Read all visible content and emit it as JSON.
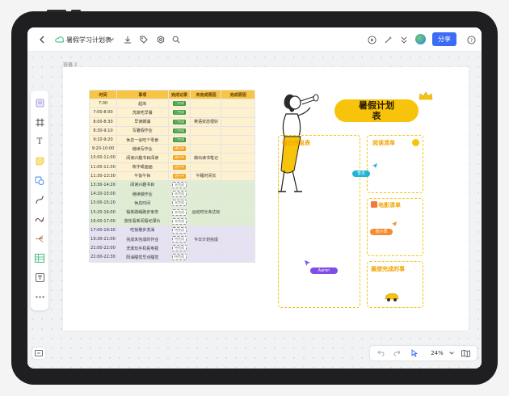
{
  "toolbar": {
    "doc_title": "暑假学习计划表",
    "share_label": "分享",
    "icons": [
      "back-icon",
      "cloud-icon",
      "dropdown-icon",
      "download-icon",
      "tag-icon",
      "settings-icon",
      "search-icon",
      "play-icon",
      "magic-icon",
      "more-icon",
      "avatar",
      "help-icon"
    ]
  },
  "canvas": {
    "container_label": "容器 2"
  },
  "schedule": {
    "headers": [
      "时间",
      "事项",
      "完成记录",
      "未完成原因",
      "完成原因"
    ],
    "rows": [
      {
        "time": "7:00",
        "task": "起床",
        "status": "已完成",
        "status_type": "done",
        "reason": "",
        "color": "#fdf1cf"
      },
      {
        "time": "7:00-8:00",
        "task": "洗漱吃早餐",
        "status": "已完成",
        "status_type": "done",
        "reason": "",
        "color": "#fdf1cf"
      },
      {
        "time": "8:00-8:30",
        "task": "早读朗诵",
        "status": "已完成",
        "status_type": "done",
        "reason": "英语状态很好",
        "color": "#fdf1cf"
      },
      {
        "time": "8:30-9:10",
        "task": "写暑假作业",
        "status": "已完成",
        "status_type": "done",
        "reason": "",
        "color": "#fdf1cf"
      },
      {
        "time": "9:10-9:20",
        "task": "休息一会吃个零食",
        "status": "已完成",
        "status_type": "done",
        "reason": "",
        "color": "#fdf1cf"
      },
      {
        "time": "9:20-10:00",
        "task": "继续写作业",
        "status": "进行中",
        "status_type": "progress",
        "reason": "",
        "color": "#fdf1cf"
      },
      {
        "time": "10:00-11:00",
        "task": "阅读兴趣书目阅读",
        "status": "进行中",
        "status_type": "progress",
        "reason": "做出读书笔记",
        "color": "#fdf1cf"
      },
      {
        "time": "11:00-11:30",
        "task": "练字或画画",
        "status": "进行中",
        "status_type": "progress",
        "reason": "",
        "color": "#fdf1cf"
      },
      {
        "time": "11:30-13:30",
        "task": "午饭午休",
        "status": "进行中",
        "status_type": "progress",
        "reason": "午睡时间长",
        "color": "#fdf1cf"
      },
      {
        "time": "13:30-14:20",
        "task": "阅读兴趣书目",
        "status": "未完成",
        "status_type": "todo",
        "reason": "",
        "color": "#dfeed3"
      },
      {
        "time": "14:20-15:00",
        "task": "继续做作业",
        "status": "未完成",
        "status_type": "todo",
        "reason": "",
        "color": "#dfeed3"
      },
      {
        "time": "15:00-15:20",
        "task": "休息时间",
        "status": "未完成",
        "status_type": "todo",
        "reason": "",
        "color": "#dfeed3"
      },
      {
        "time": "15:20-16:00",
        "task": "锻炼跳绳跑步家务",
        "status": "未完成",
        "status_type": "todo",
        "reason": "运动时长未达标",
        "color": "#dfeed3"
      },
      {
        "time": "16:00-17:00",
        "task": "放松看新闻看纪录片",
        "status": "未完成",
        "status_type": "todo",
        "reason": "",
        "color": "#dfeed3"
      },
      {
        "time": "17:00-19:30",
        "task": "吃饭散步洗澡",
        "status": "待完成",
        "status_type": "todo",
        "reason": "",
        "color": "#e6e1f3"
      },
      {
        "time": "19:30-21:00",
        "task": "完成未完成的作业",
        "status": "待完成",
        "status_type": "todo",
        "reason": "今日计划完成",
        "color": "#e6e1f3"
      },
      {
        "time": "21:00-22:00",
        "task": "洗漱玩手机看电视",
        "status": "待完成",
        "status_type": "todo",
        "reason": "",
        "color": "#e6e1f3"
      },
      {
        "time": "22:00-22:30",
        "task": "阳澡睡觉早点睡觉",
        "status": "待完成",
        "status_type": "todo",
        "reason": "",
        "color": "#e6e1f3"
      }
    ]
  },
  "poster": {
    "title_line1": "暑假计划",
    "title_line2": "表",
    "box1": "每日作息表",
    "box2": "阅读清单",
    "box3": "电影清单",
    "box4": "最想完成的事",
    "bubble1": "李杰",
    "bubble2": "张小草",
    "bubble3": "Aaron",
    "colors": {
      "accent": "#f7c40b",
      "cyan": "#21b3d6",
      "orange": "#f48c2a",
      "purple": "#7e4de6"
    }
  },
  "bottom": {
    "zoom": "24%"
  }
}
